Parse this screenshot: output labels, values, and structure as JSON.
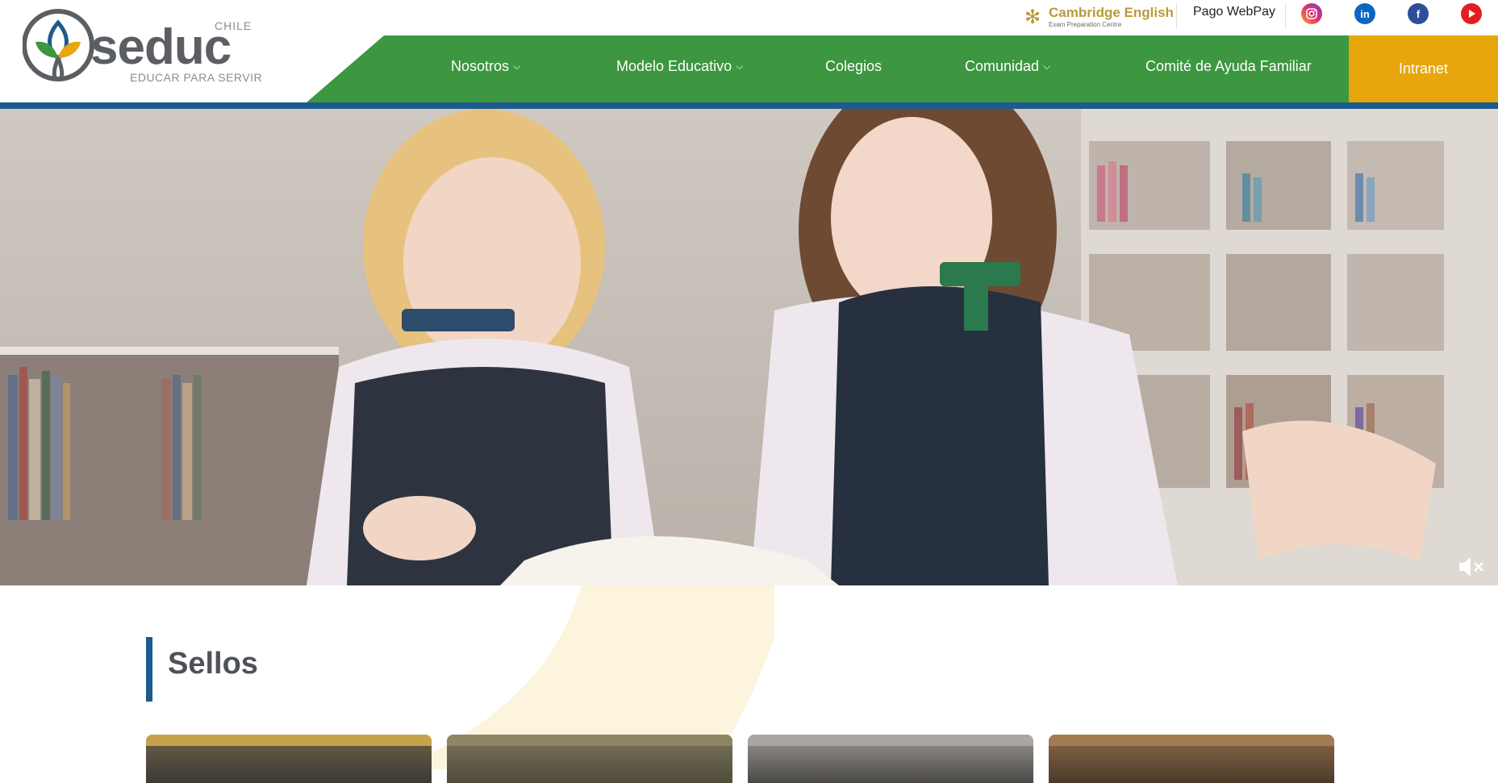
{
  "brand": {
    "name": "seduc",
    "country": "CHILE",
    "tagline": "EDUCAR PARA SERVIR",
    "colors": {
      "green": "#3d9640",
      "gold": "#e6a60c",
      "blue": "#1d5a8e",
      "gray": "#5b5e63"
    }
  },
  "topbar": {
    "cambridge_title": "Cambridge English",
    "cambridge_subtitle": "Exam Preparation Centre",
    "webpay": "Pago WebPay",
    "social": [
      {
        "name": "instagram-icon",
        "color": "#e1306c"
      },
      {
        "name": "linkedin-icon",
        "color": "#0a66c2"
      },
      {
        "name": "facebook-icon",
        "color": "#2d4f9b"
      },
      {
        "name": "youtube-icon",
        "color": "#e02020"
      }
    ]
  },
  "nav": {
    "items": [
      {
        "label": "Nosotros",
        "dropdown": true
      },
      {
        "label": "Modelo Educativo",
        "dropdown": true
      },
      {
        "label": "Colegios",
        "dropdown": false
      },
      {
        "label": "Comunidad",
        "dropdown": true
      },
      {
        "label": "Comité de Ayuda Familiar",
        "dropdown": false
      }
    ],
    "intranet": "Intranet"
  },
  "hero": {
    "muted": true
  },
  "section": {
    "title": "Sellos"
  }
}
